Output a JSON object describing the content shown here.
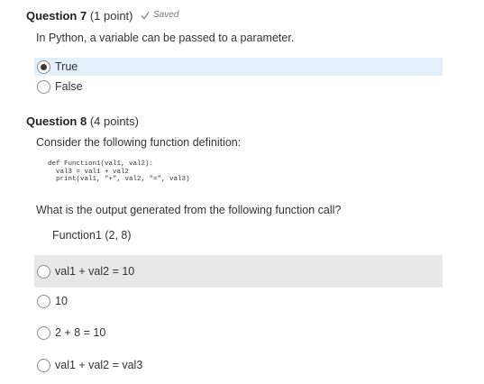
{
  "q7": {
    "number": "Question 7",
    "points": "(1 point)",
    "saved": "Saved",
    "prompt": "In Python, a variable can be passed to a parameter.",
    "options": [
      {
        "label": "True",
        "selected": true
      },
      {
        "label": "False",
        "selected": false
      }
    ]
  },
  "q8": {
    "number": "Question 8",
    "points": "(4 points)",
    "prompt": "Consider the following function definition:",
    "code": "def Function1(val1, val2):\n  val3 = val1 + val2\n  print(val1, \"+\", val2, \"=\", val3)",
    "question": "What is the output generated from the following function call?",
    "call": "Function1 (2, 8)",
    "options": [
      {
        "label": "val1 + val2 = 10",
        "selected": false
      },
      {
        "label": "10",
        "selected": false
      },
      {
        "label": "2 + 8 = 10",
        "selected": false
      },
      {
        "label": "val1 + val2 = val3",
        "selected": false
      }
    ]
  },
  "colors": {
    "selected_row_bg": "#e3effb",
    "hover_row_bg": "#e8e8e8"
  }
}
